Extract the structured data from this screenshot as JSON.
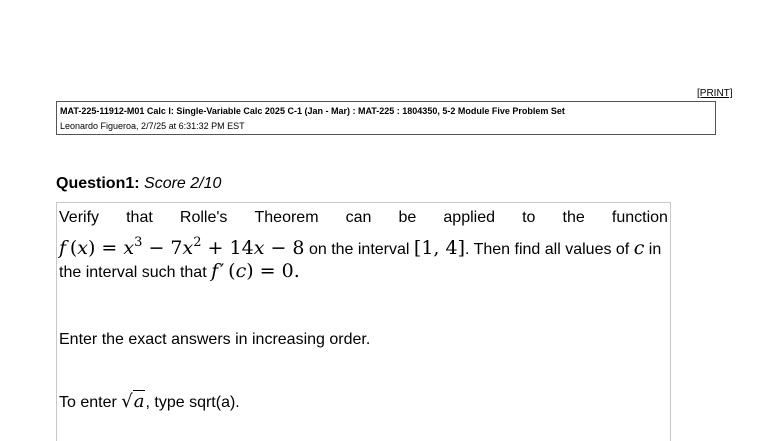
{
  "print_label": "[PRINT]",
  "header": {
    "course_line": "MAT-225-11912-M01 Calc I: Single-Variable Calc 2025 C-1 (Jan - Mar) : MAT-225 : 1804350, 5-2 Module Five Problem Set",
    "user_line": "Leonardo Figueroa, 2/7/25 at 6:31:32 PM EST"
  },
  "question": {
    "label": "Question1:",
    "score": "Score 2/10",
    "words_line1": [
      "Verify",
      "that",
      "Rolle's",
      "Theorem",
      "can",
      "be",
      "applied",
      "to",
      "the",
      "function"
    ],
    "on_interval_text": " on the interval ",
    "then_find_text": ". Then find all values of ",
    "in_text": " in",
    "interval_such_text": "the interval such that ",
    "instruction": "Enter the exact answers in increasing order.",
    "sqrt_prefix": "To enter ",
    "sqrt_suffix": ", type sqrt(a)."
  }
}
